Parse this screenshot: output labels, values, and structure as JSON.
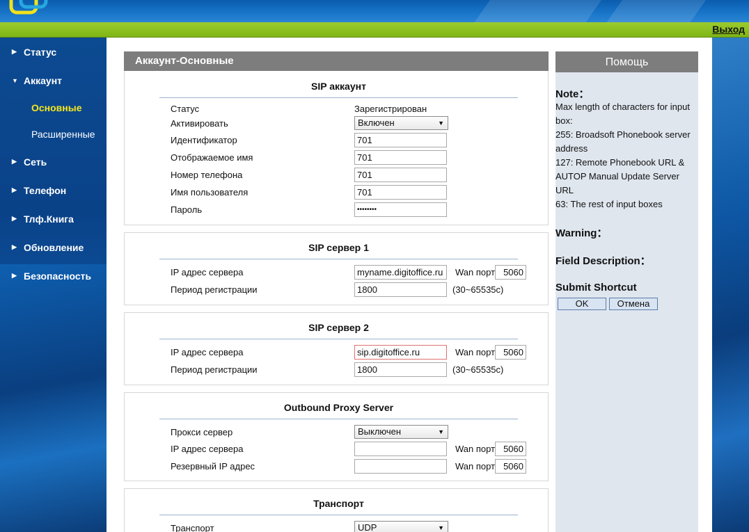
{
  "header": {
    "logout_label": "Выход"
  },
  "sidebar": {
    "items": [
      {
        "label": "Статус",
        "expanded": false
      },
      {
        "label": "Аккаунт",
        "expanded": true
      },
      {
        "label": "Сеть",
        "expanded": false
      },
      {
        "label": "Телефон",
        "expanded": false
      },
      {
        "label": "Тлф.Книга",
        "expanded": false
      },
      {
        "label": "Обновление",
        "expanded": false
      },
      {
        "label": "Безопасность",
        "expanded": false
      }
    ],
    "subitems": [
      {
        "label": "Основные",
        "active": true
      },
      {
        "label": "Расширенные",
        "active": false
      }
    ]
  },
  "main": {
    "title": "Аккаунт-Основные",
    "sip_account": {
      "title": "SIP аккаунт",
      "status_label": "Статус",
      "status_value": "Зарегистрирован",
      "activate_label": "Активировать",
      "activate_value": "Включен",
      "id_label": "Идентификатор",
      "id_value": "701",
      "display_name_label": "Отображаемое имя",
      "display_name_value": "701",
      "phone_label": "Номер телефона",
      "phone_value": "701",
      "username_label": "Имя пользователя",
      "username_value": "701",
      "password_label": "Пароль",
      "password_value": "••••••••"
    },
    "sip_server1": {
      "title": "SIP сервер 1",
      "ip_label": "IP адрес сервера",
      "ip_value": "myname.digitoffice.ru",
      "wan_label": "Wan порт",
      "wan_value": "5060",
      "period_label": "Период регистрации",
      "period_value": "1800",
      "range": "(30~65535c)"
    },
    "sip_server2": {
      "title": "SIP сервер 2",
      "ip_label": "IP адрес сервера",
      "ip_value": "sip.digitoffice.ru",
      "wan_label": "Wan порт",
      "wan_value": "5060",
      "period_label": "Период регистрации",
      "period_value": "1800",
      "range": "(30~65535c)"
    },
    "outbound_proxy": {
      "title": "Outbound Proxy Server",
      "proxy_label": "Прокси сервер",
      "proxy_value": "Выключен",
      "ip_label": "IP адрес сервера",
      "ip_value": "",
      "wan_label": "Wan порт",
      "wan_value": "5060",
      "backup_label": "Резервный IP адрес",
      "backup_value": "",
      "wan2_label": "Wan порт",
      "wan2_value": "5060"
    },
    "transport": {
      "title": "Транспорт",
      "label": "Транспорт",
      "value": "UDP"
    }
  },
  "help": {
    "title": "Помощь",
    "note_head": "Note：",
    "note_lines": [
      "Max length of characters for input box:",
      "255: Broadsoft Phonebook server address",
      "127: Remote Phonebook URL & AUTOP Manual Update Server URL",
      "63: The rest of input boxes"
    ],
    "warning_head": "Warning：",
    "field_desc_head": "Field Description：",
    "submit_head": "Submit Shortcut",
    "ok_label": "OK",
    "cancel_label": "Отмена"
  },
  "colors": {
    "accent_green": "#8cc21f",
    "panel_header_gray": "#7d7d7d",
    "active_nav_yellow": "#f6e61a",
    "help_bg": "#dfe6ee"
  },
  "icons": {
    "nav_collapsed": "triangle-right-icon",
    "nav_expanded": "triangle-down-icon",
    "select_arrow": "caret-down-icon"
  }
}
